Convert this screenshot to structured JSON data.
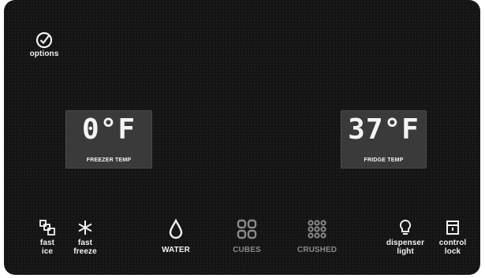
{
  "options": {
    "label": "options",
    "icon": "checkmark-circle-icon"
  },
  "freezer": {
    "temp": "0°F",
    "caption": "FREEZER TEMP"
  },
  "fridge": {
    "temp": "37°F",
    "caption": "FRIDGE TEMP"
  },
  "controls": {
    "fast_ice": {
      "label": "fast\nice",
      "icon": "ice-cubes-icon"
    },
    "fast_freeze": {
      "label": "fast\nfreeze",
      "icon": "snowflake-icon"
    },
    "water": {
      "label": "WATER",
      "icon": "water-drop-icon",
      "active": true
    },
    "cubes": {
      "label": "CUBES",
      "icon": "cubes-icon",
      "active": false
    },
    "crushed": {
      "label": "CRUSHED",
      "icon": "crushed-ice-icon",
      "active": false
    },
    "dispenser_light": {
      "label": "dispenser\nlight",
      "icon": "light-bulb-icon"
    },
    "control_lock": {
      "label": "control\nlock",
      "icon": "lock-icon"
    }
  },
  "colors": {
    "panel": "#141414",
    "display_bg": "#3a3a3a",
    "text": "#f2f2f2",
    "inactive": "#8a8a8a"
  }
}
